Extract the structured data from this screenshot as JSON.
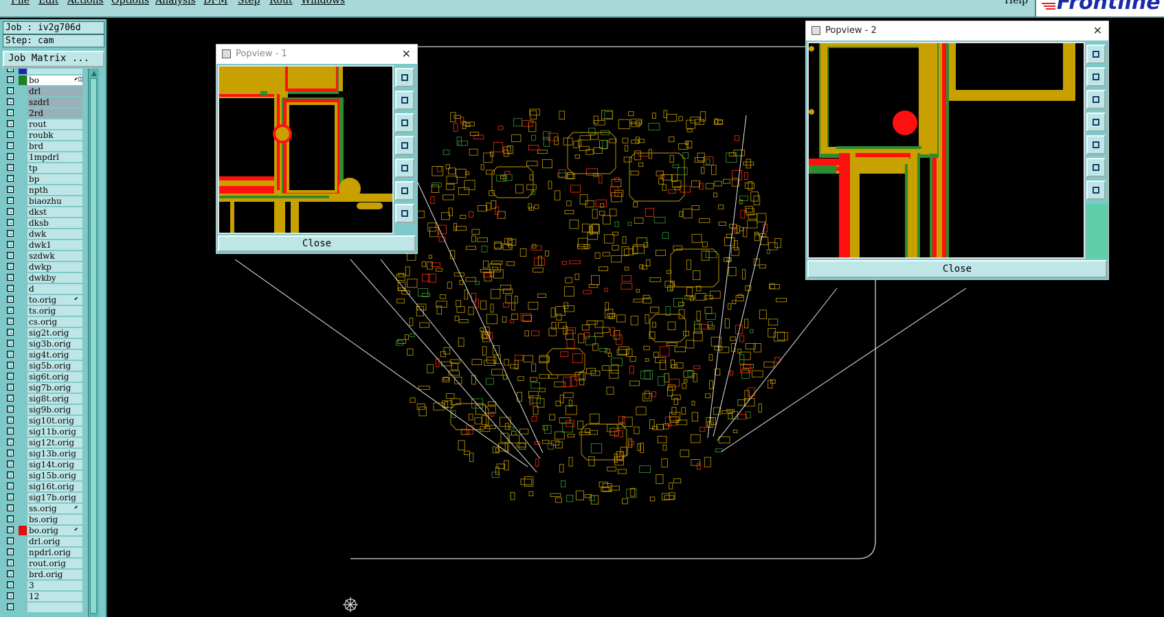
{
  "menu": [
    "File",
    "Edit",
    "Actions",
    "Options",
    "Analysis",
    "DFM",
    "Step",
    "Rout",
    "Windows"
  ],
  "help_label": "Help",
  "logo_text": "Frontline",
  "job_label": "Job : iv2g706d",
  "step_label": "Step: cam",
  "job_matrix_label": "Job Matrix ...",
  "layers": [
    {
      "name": "",
      "swatch": "#1a2aa8"
    },
    {
      "name": "bo",
      "swatch": "#1f7f1f",
      "selected": true,
      "mark": "⬋◫"
    },
    {
      "name": "drl",
      "grey": true
    },
    {
      "name": "szdrl",
      "grey": true
    },
    {
      "name": "2rd",
      "grey": true
    },
    {
      "name": "rout"
    },
    {
      "name": "roubk"
    },
    {
      "name": "brd"
    },
    {
      "name": "1mpdrl"
    },
    {
      "name": "tp"
    },
    {
      "name": "bp"
    },
    {
      "name": "npth"
    },
    {
      "name": "biaozhu"
    },
    {
      "name": "dkst"
    },
    {
      "name": "dksb"
    },
    {
      "name": "dwk"
    },
    {
      "name": "dwk1"
    },
    {
      "name": "szdwk"
    },
    {
      "name": "dwkp"
    },
    {
      "name": "dwkby"
    },
    {
      "name": "d"
    },
    {
      "name": "to.orig",
      "mark": "⬋"
    },
    {
      "name": "ts.orig"
    },
    {
      "name": "cs.orig"
    },
    {
      "name": "sig2t.orig"
    },
    {
      "name": "sig3b.orig"
    },
    {
      "name": "sig4t.orig"
    },
    {
      "name": "sig5b.orig"
    },
    {
      "name": "sig6t.orig"
    },
    {
      "name": "sig7b.orig"
    },
    {
      "name": "sig8t.orig"
    },
    {
      "name": "sig9b.orig"
    },
    {
      "name": "sig10t.orig"
    },
    {
      "name": "sig11b.orig"
    },
    {
      "name": "sig12t.orig"
    },
    {
      "name": "sig13b.orig"
    },
    {
      "name": "sig14t.orig"
    },
    {
      "name": "sig15b.orig"
    },
    {
      "name": "sig16t.orig"
    },
    {
      "name": "sig17b.orig"
    },
    {
      "name": "ss.orig",
      "mark": "⬋"
    },
    {
      "name": "bs.orig"
    },
    {
      "name": "bo.orig",
      "swatch": "#e01010",
      "mark": "⬋"
    },
    {
      "name": "drl.orig"
    },
    {
      "name": "npdrl.orig"
    },
    {
      "name": "rout.orig"
    },
    {
      "name": "brd.orig"
    },
    {
      "name": "3"
    },
    {
      "name": "12"
    },
    {
      "name": ""
    }
  ],
  "popup1": {
    "title": "Popview - 1",
    "close_label": "Close"
  },
  "popup2": {
    "title": "Popview - 2",
    "close_label": "Close"
  },
  "colors": {
    "panel": "#7fc8c8",
    "panel_light": "#bfe6e6",
    "copper": "#c8a000",
    "red": "#ff1010",
    "green": "#2e8b2e",
    "background": "#000000"
  }
}
